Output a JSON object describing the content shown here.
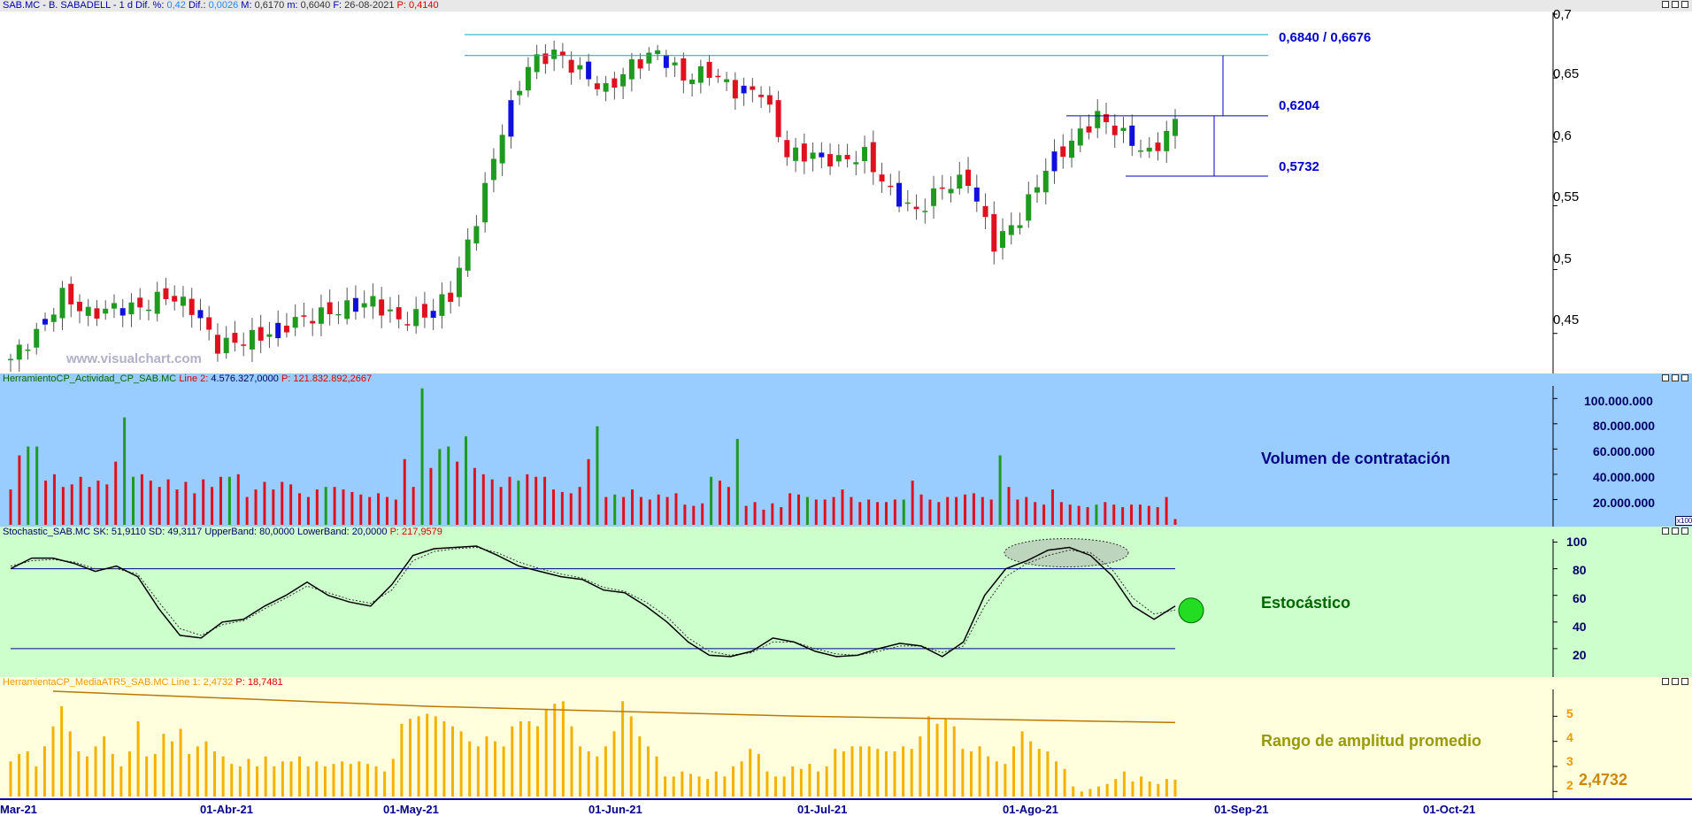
{
  "price_panel": {
    "header": {
      "symbol": "SAB.MC - B. SABADELL -",
      "timeframe": "1 d",
      "change_pct_label": "Dif. %:",
      "change_pct_value": "0,42",
      "change_label": "Dif.:",
      "change_value": "0,0026",
      "max_label": "M:",
      "max_value": "0,6170",
      "min_label": "m:",
      "min_value": "0,6040",
      "date_label": "F:",
      "date_value": "26-08-2021",
      "p_label": "P:",
      "p_value": "0,4140"
    },
    "watermark": "www.visualchart.com",
    "yticks": [
      "0,7",
      "0,65",
      "0,6",
      "0,55",
      "0,5",
      "0,45"
    ],
    "levels": {
      "high_label": "0,6840 / 0,6676",
      "mid_label": "0,6204",
      "low_label": "0,5732"
    }
  },
  "volume_panel": {
    "header": {
      "name": "HerramientoCP_Actividad_CP_SAB.MC",
      "line_label": "Line 2:",
      "line_value": "4.576.327,0000",
      "p_label": "P:",
      "p_value": "121.832.892,2667"
    },
    "title": "Volumen de contratación",
    "yticks": [
      "100.000.000",
      "80.000.000",
      "60.000.000",
      "40.000.000",
      "20.000.000"
    ],
    "scale_note": "x100"
  },
  "stoch_panel": {
    "header": {
      "name": "Stochastic_SAB.MC",
      "sk_label": "SK:",
      "sk_value": "51,9110",
      "sd_label": "SD:",
      "sd_value": "49,3117",
      "upper_label": "UpperBand:",
      "upper_value": "80,0000",
      "lower_label": "LowerBand:",
      "lower_value": "20,0000",
      "p_label": "P:",
      "p_value": "217,9579"
    },
    "title": "Estocástico",
    "yticks": [
      "100",
      "80",
      "60",
      "40",
      "20"
    ]
  },
  "atr_panel": {
    "header": {
      "name": "HerramientaCP_MediaATR5_SAB.MC",
      "line_label": "Line 1:",
      "line_value": "2,4732",
      "p_label": "P:",
      "p_value": "18,7481"
    },
    "title": "Rango de amplitud promedio",
    "yticks": [
      "5",
      "4",
      "3",
      "2"
    ],
    "current_value": "2,4732"
  },
  "x_axis": {
    "labels": [
      "Mar-21",
      "01-Abr-21",
      "01-May-21",
      "01-Jun-21",
      "01-Jul-21",
      "01-Ago-21",
      "01-Sep-21",
      "01-Oct-21"
    ]
  },
  "colors": {
    "up": "#1e9a1e",
    "down": "#e0101e",
    "blue_candle": "#1010dd",
    "volume_bg": "#99ccff",
    "stoch_bg": "#ccffcc",
    "atr_bg": "#ffffdd",
    "atr_bar": "#f5b100",
    "level_line": "#00aacc",
    "level_text": "#0000cc"
  },
  "chart_data": [
    {
      "type": "candlestick",
      "title": "SAB.MC - B. SABADELL - 1 d",
      "x_start": "2021-03-25",
      "x_end": "2021-08-26",
      "ylim": [
        0.42,
        0.7
      ],
      "yticks": [
        0.45,
        0.5,
        0.55,
        0.6,
        0.65,
        0.7
      ],
      "close_path": [
        0.43,
        0.45,
        0.48,
        0.465,
        0.47,
        0.47,
        0.48,
        0.47,
        0.44,
        0.445,
        0.45,
        0.46,
        0.465,
        0.47,
        0.475,
        0.46,
        0.465,
        0.48,
        0.54,
        0.61,
        0.66,
        0.67,
        0.655,
        0.64,
        0.66,
        0.67,
        0.65,
        0.655,
        0.64,
        0.64,
        0.59,
        0.59,
        0.585,
        0.59,
        0.56,
        0.545,
        0.565,
        0.57,
        0.52,
        0.54,
        0.58,
        0.6,
        0.62,
        0.605,
        0.59,
        0.615
      ],
      "levels": [
        0.684,
        0.6676,
        0.6204,
        0.5732
      ],
      "level_labels": [
        "0,6840 / 0,6676",
        "0,6204",
        "0,5732"
      ]
    },
    {
      "type": "bar",
      "title": "Volumen de contratación",
      "ylim": [
        0,
        110000000
      ],
      "yticks": [
        20000000,
        40000000,
        60000000,
        80000000,
        100000000
      ],
      "values": [
        28000000,
        55000000,
        62000000,
        62000000,
        35000000,
        40000000,
        30000000,
        32000000,
        38000000,
        30000000,
        35000000,
        32000000,
        50000000,
        85000000,
        38000000,
        40000000,
        35000000,
        30000000,
        36000000,
        28000000,
        34000000,
        25000000,
        36000000,
        30000000,
        38000000,
        38000000,
        40000000,
        22000000,
        28000000,
        34000000,
        28000000,
        34000000,
        32000000,
        25000000,
        22000000,
        28000000,
        30000000,
        30000000,
        28000000,
        26000000,
        24000000,
        22000000,
        25000000,
        22000000,
        20000000,
        52000000,
        30000000,
        108000000,
        45000000,
        60000000,
        62000000,
        50000000,
        70000000,
        45000000,
        40000000,
        36000000,
        30000000,
        38000000,
        35000000,
        40000000,
        38000000,
        38000000,
        28000000,
        26000000,
        25000000,
        30000000,
        52000000,
        78000000,
        22000000,
        24000000,
        22000000,
        28000000,
        22000000,
        20000000,
        24000000,
        22000000,
        25000000,
        16000000,
        15000000,
        17000000,
        38000000,
        35000000,
        30000000,
        68000000,
        15000000,
        18000000,
        12000000,
        17000000,
        14000000,
        25000000,
        24000000,
        22000000,
        20000000,
        20000000,
        22000000,
        28000000,
        22000000,
        18000000,
        20000000,
        18000000,
        18000000,
        20000000,
        20000000,
        35000000,
        24000000,
        20000000,
        18000000,
        22000000,
        22000000,
        24000000,
        25000000,
        22000000,
        20000000,
        55000000,
        30000000,
        20000000,
        22000000,
        18000000,
        16000000,
        28000000,
        18000000,
        16000000,
        15000000,
        14000000,
        16000000,
        18000000,
        16000000,
        14000000,
        16000000,
        16000000,
        15000000,
        14000000,
        22000000,
        4576327
      ]
    },
    {
      "type": "line",
      "title": "Estocástico",
      "ylim": [
        0,
        105
      ],
      "yticks": [
        20,
        40,
        60,
        80,
        100
      ],
      "bands": [
        80,
        20
      ],
      "series": [
        {
          "name": "SK",
          "values": [
            80,
            88,
            88,
            84,
            78,
            82,
            74,
            50,
            30,
            28,
            40,
            42,
            52,
            60,
            70,
            60,
            55,
            52,
            68,
            90,
            95,
            96,
            97,
            90,
            82,
            78,
            74,
            72,
            64,
            62,
            52,
            40,
            25,
            15,
            14,
            18,
            28,
            25,
            18,
            14,
            15,
            20,
            24,
            22,
            14,
            25,
            60,
            80,
            86,
            94,
            96,
            90,
            75,
            52,
            42,
            52
          ]
        },
        {
          "name": "SD",
          "values": [
            82,
            86,
            87,
            85,
            80,
            80,
            76,
            55,
            35,
            30,
            38,
            41,
            50,
            58,
            67,
            62,
            57,
            54,
            64,
            86,
            93,
            95,
            96,
            92,
            85,
            80,
            76,
            73,
            66,
            63,
            55,
            44,
            28,
            18,
            15,
            17,
            25,
            25,
            20,
            16,
            15,
            18,
            22,
            22,
            17,
            22,
            52,
            74,
            84,
            90,
            94,
            92,
            80,
            58,
            46,
            49
          ]
        }
      ]
    },
    {
      "type": "bar",
      "title": "Rango de amplitud promedio",
      "ylim": [
        1.8,
        6
      ],
      "yticks": [
        2,
        3,
        4,
        5
      ],
      "values": [
        3.2,
        3.5,
        3.6,
        3.0,
        3.8,
        4.6,
        5.4,
        4.4,
        3.6,
        3.4,
        3.8,
        4.2,
        3.5,
        3.0,
        3.6,
        4.8,
        3.4,
        3.5,
        4.3,
        4.0,
        4.5,
        3.5,
        3.8,
        4.0,
        3.6,
        3.4,
        3.1,
        3.0,
        3.3,
        3.0,
        3.4,
        3.0,
        3.2,
        3.2,
        3.4,
        3.0,
        3.2,
        3.0,
        3.1,
        3.2,
        3.1,
        3.2,
        3.1,
        3.0,
        2.8,
        3.3,
        4.7,
        4.9,
        5.0,
        5.1,
        5.0,
        4.8,
        4.6,
        4.4,
        4.0,
        3.8,
        4.2,
        4.0,
        3.8,
        4.6,
        4.8,
        4.8,
        4.6,
        5.3,
        5.5,
        5.6,
        4.6,
        3.8,
        3.6,
        3.4,
        3.8,
        4.4,
        5.6,
        5.0,
        4.2,
        3.8,
        3.4,
        2.6,
        2.6,
        2.8,
        2.7,
        2.6,
        2.5,
        2.8,
        2.6,
        3.0,
        3.2,
        3.7,
        3.5,
        2.8,
        2.6,
        2.6,
        3.0,
        2.9,
        3.1,
        2.8,
        3.0,
        3.7,
        3.6,
        3.8,
        3.8,
        3.8,
        3.7,
        3.6,
        3.6,
        3.8,
        3.7,
        4.2,
        5.0,
        4.7,
        4.9,
        4.6,
        3.7,
        3.6,
        3.8,
        3.4,
        3.2,
        3.1,
        3.8,
        4.4,
        4.0,
        3.7,
        3.6,
        3.2,
        2.9,
        2.2,
        2.0,
        2.1,
        2.2,
        2.3,
        2.5,
        2.8,
        2.4,
        2.6,
        2.4,
        2.3,
        2.5,
        2.47
      ],
      "series": [
        {
          "name": "Line 1",
          "values": [
            6.0,
            5.4,
            5.0,
            4.75
          ]
        }
      ]
    }
  ]
}
